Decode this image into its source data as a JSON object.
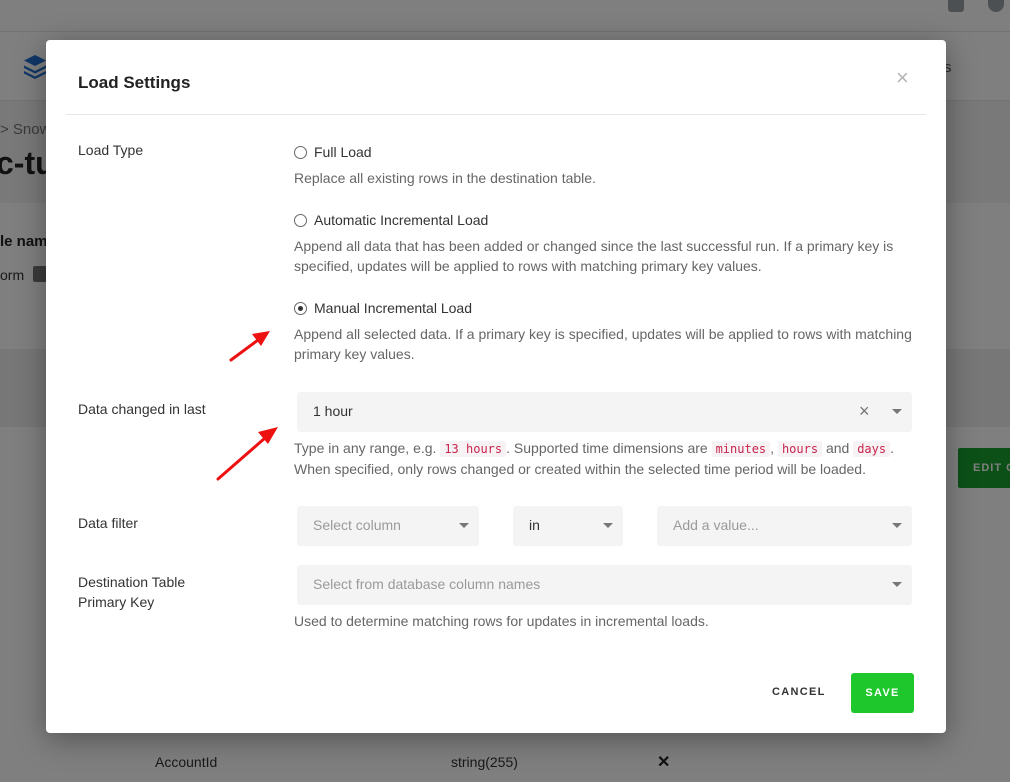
{
  "background": {
    "nav_partial": "s",
    "breadcrumb_partial": "> Snow",
    "title_partial": "c-tu",
    "name_partial": "le nam",
    "form_partial": "orm",
    "edit_button_partial": "EDIT C",
    "row": {
      "name": "AccountId",
      "type": "string(255)",
      "remove": "✕"
    }
  },
  "modal": {
    "title": "Load Settings",
    "close": "×",
    "load_type": {
      "label": "Load Type",
      "options": [
        {
          "label": "Full Load",
          "help": "Replace all existing rows in the destination table.",
          "selected": false
        },
        {
          "label": "Automatic Incremental Load",
          "help": "Append all data that has been added or changed since the last successful run. If a primary key is specified, updates will be applied to rows with matching primary key values.",
          "selected": false
        },
        {
          "label": "Manual Incremental Load",
          "help": "Append all selected data. If a primary key is specified, updates will be applied to rows with matching primary key values.",
          "selected": true
        }
      ]
    },
    "data_changed": {
      "label": "Data changed in last",
      "value": "1 hour",
      "clear": "×",
      "help_before": "Type in any range, e.g.",
      "example": "13 hours",
      "help_middle": ". Supported time dimensions are",
      "dim1": "minutes",
      "comma": ",",
      "dim2": "hours",
      "and": "and",
      "dim3": "days",
      "period": ".",
      "help_line2": "When specified, only rows changed or created within the selected time period will be loaded."
    },
    "data_filter": {
      "label": "Data filter",
      "column_placeholder": "Select column",
      "operator": "in",
      "value_placeholder": "Add a value..."
    },
    "primary_key": {
      "label_line1": "Destination Table",
      "label_line2": "Primary Key",
      "placeholder": "Select from database column names",
      "help": "Used to determine matching rows for updates in incremental loads."
    },
    "cancel": "CANCEL",
    "save": "SAVE"
  },
  "colors": {
    "save": "#1ec72b",
    "edit": "#19a12e",
    "logo": "#1f6fd1",
    "annotation_arrow": "#ee1111",
    "code_text": "#c7254e"
  }
}
